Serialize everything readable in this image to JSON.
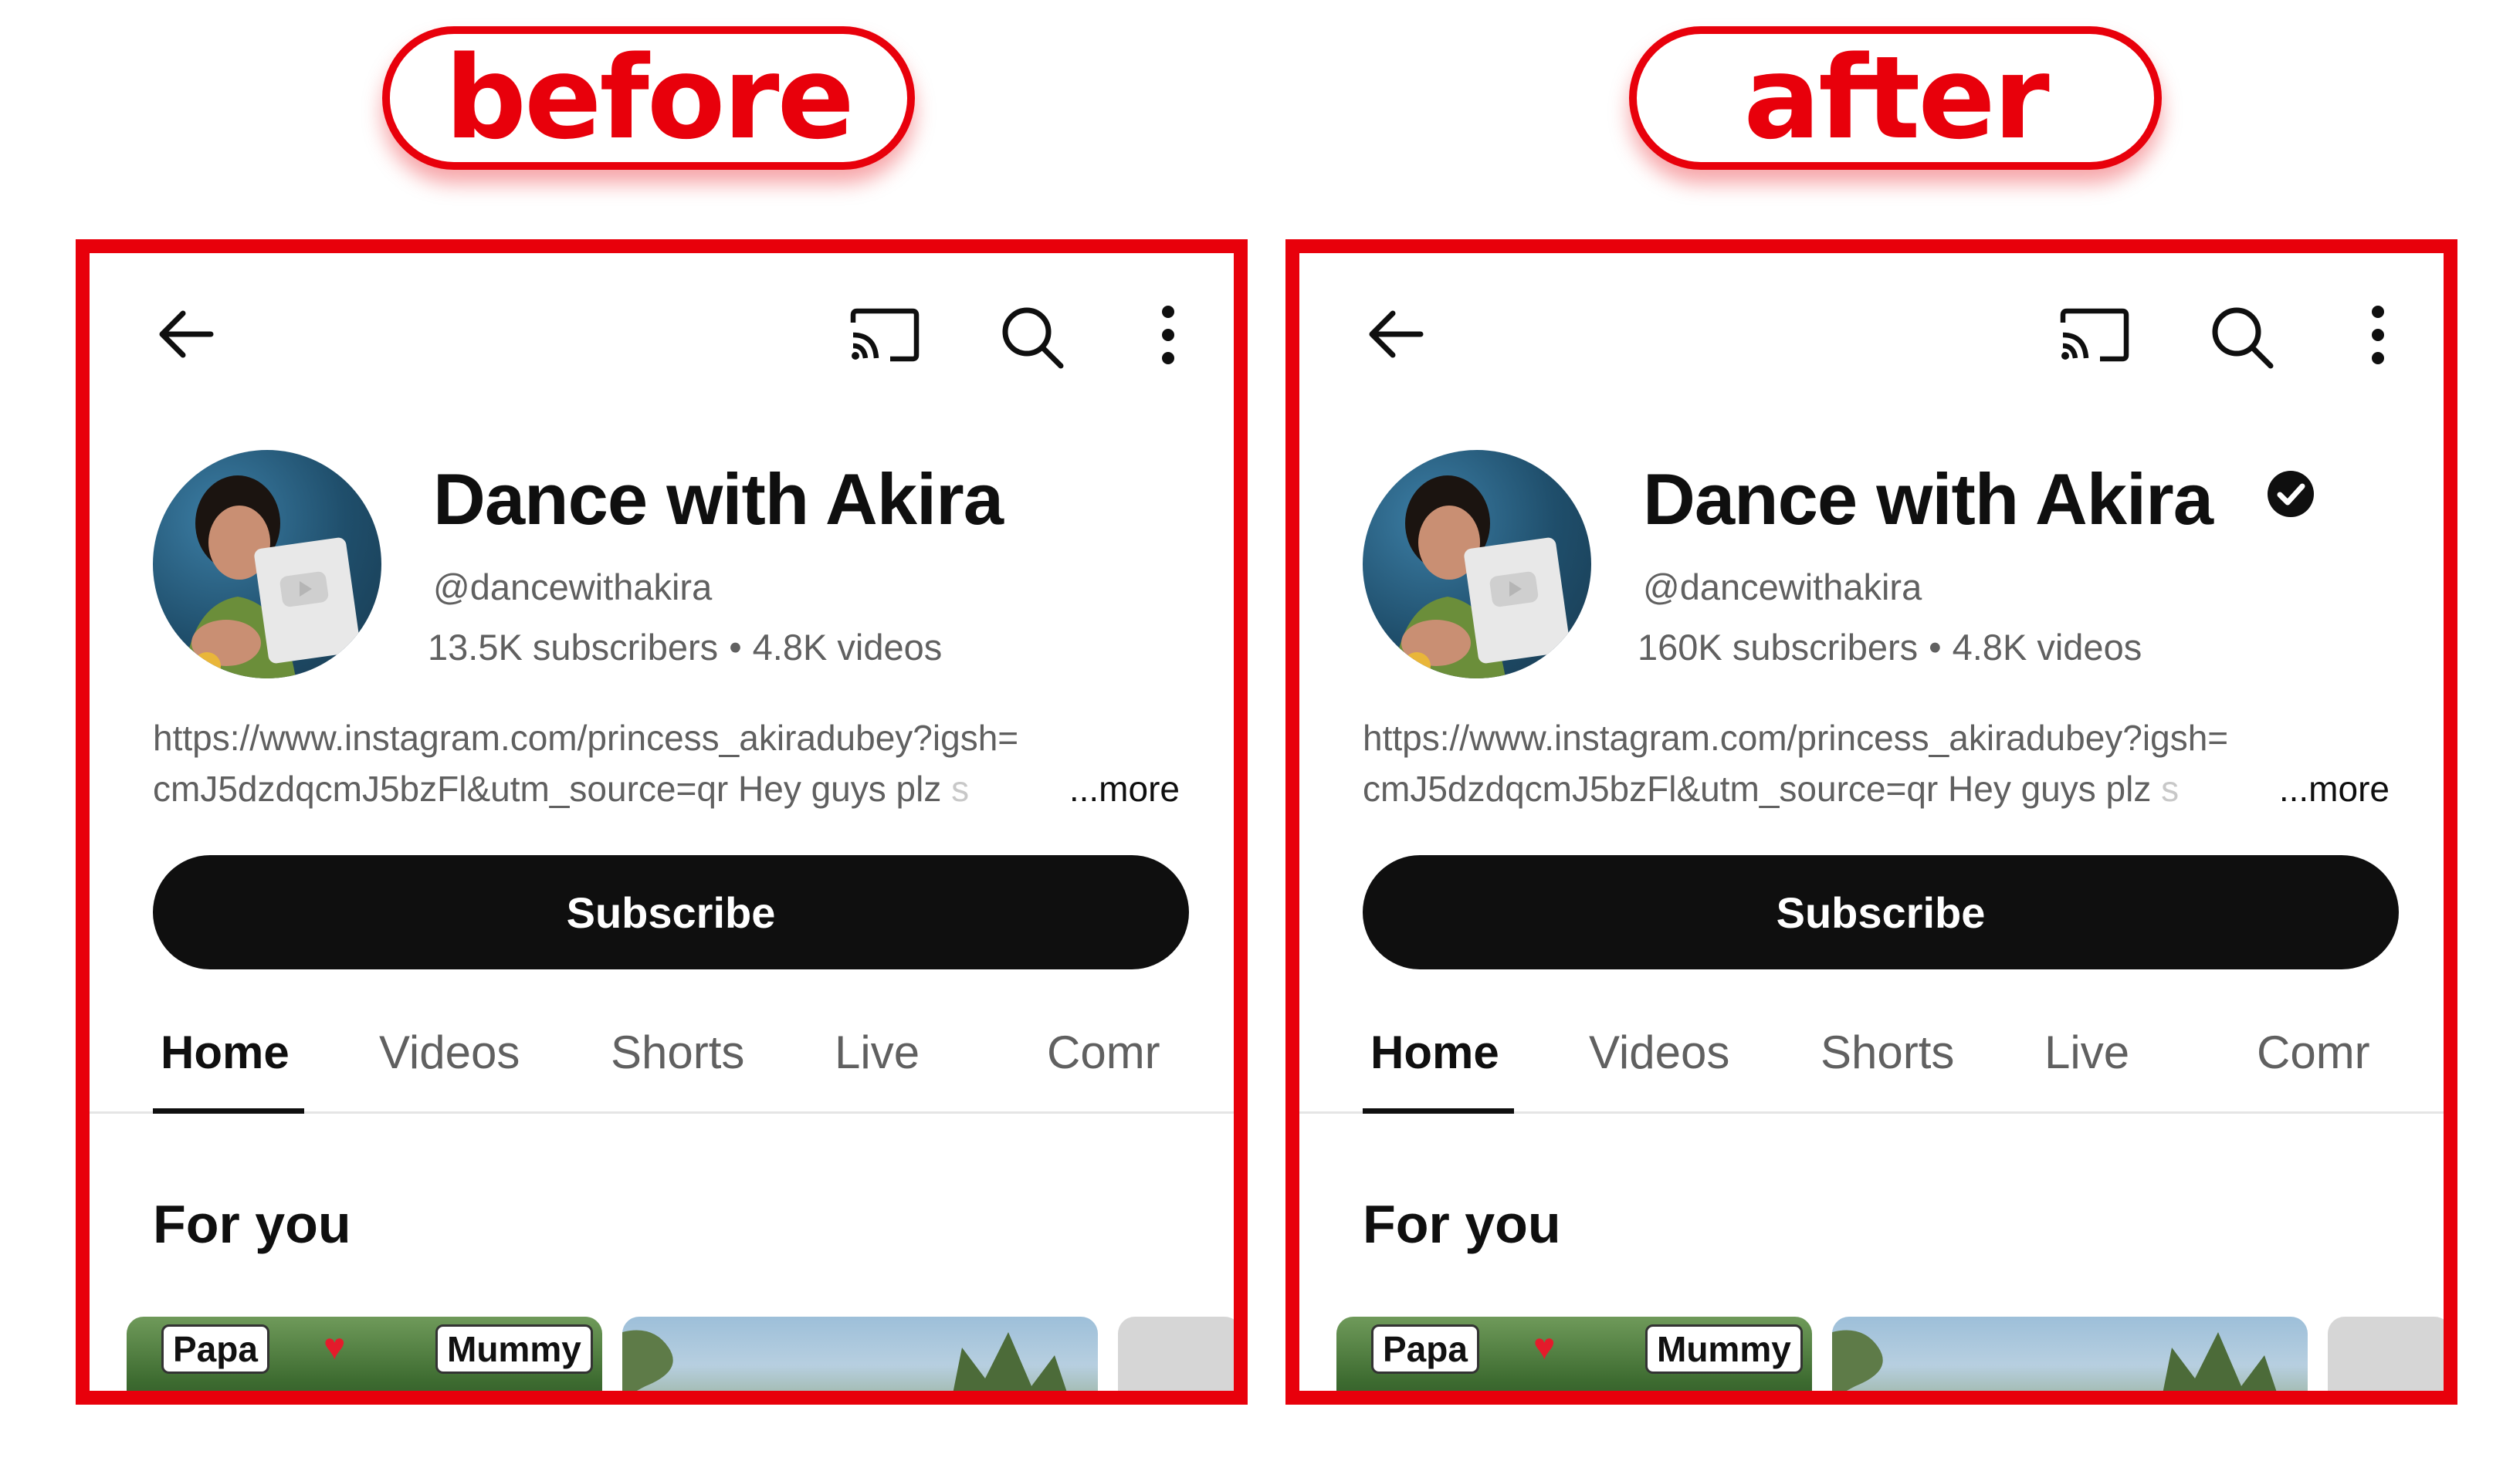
{
  "labels": {
    "before": "before",
    "after": "after"
  },
  "panels": [
    {
      "id": "before",
      "channel_name": "Dance with Akira",
      "verified": false,
      "handle": "@dancewithakira",
      "subscribers": "13.5K subscribers",
      "videos": "4.8K videos",
      "stats_separator": "•",
      "description_line1": "https://www.instagram.com/princess_akiradubey?igsh=",
      "description_line2": "cmJ5dzdqcmJ5bzFl&utm_source=qr Hey guys plz ",
      "description_fade": "s",
      "more_label": "...more",
      "subscribe_label": "Subscribe",
      "tabs": [
        "Home",
        "Videos",
        "Shorts",
        "Live",
        "Comr"
      ],
      "section_title": "For you",
      "thumb_tags": {
        "left": "Papa",
        "right": "Mummy",
        "heart": "♥"
      }
    },
    {
      "id": "after",
      "channel_name": "Dance with Akira",
      "verified": true,
      "handle": "@dancewithakira",
      "subscribers": "160K subscribers",
      "videos": "4.8K videos",
      "stats_separator": "•",
      "description_line1": "https://www.instagram.com/princess_akiradubey?igsh=",
      "description_line2": "cmJ5dzdqcmJ5bzFl&utm_source=qr Hey guys plz ",
      "description_fade": "s",
      "more_label": "...more",
      "subscribe_label": "Subscribe",
      "tabs": [
        "Home",
        "Videos",
        "Shorts",
        "Live",
        "Comr"
      ],
      "section_title": "For you",
      "thumb_tags": {
        "left": "Papa",
        "right": "Mummy",
        "heart": "♥"
      }
    }
  ],
  "icons": [
    "back-arrow-icon",
    "cast-icon",
    "search-icon",
    "more-vert-icon",
    "verified-check-icon",
    "heart-icon"
  ],
  "colors": {
    "accent_red": "#e8000b",
    "button_black": "#0f0f0f",
    "secondary_text": "#606060"
  }
}
